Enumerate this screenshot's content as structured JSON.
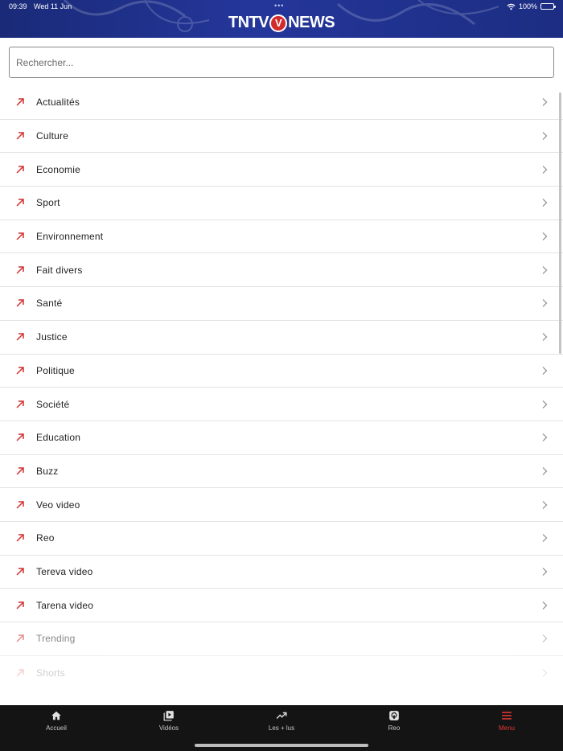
{
  "status_bar": {
    "time": "09:39",
    "date": "Wed 11 Jun",
    "dots": "•••",
    "battery": "100%"
  },
  "header": {
    "logo_left": "TNTV",
    "logo_badge": "V",
    "logo_right": "NEWS"
  },
  "search": {
    "placeholder": "Rechercher..."
  },
  "menu": {
    "items": [
      {
        "label": "Actualités"
      },
      {
        "label": "Culture"
      },
      {
        "label": "Economie"
      },
      {
        "label": "Sport"
      },
      {
        "label": "Environnement"
      },
      {
        "label": "Fait divers"
      },
      {
        "label": "Santé"
      },
      {
        "label": "Justice"
      },
      {
        "label": "Politique"
      },
      {
        "label": "Société"
      },
      {
        "label": "Education"
      },
      {
        "label": "Buzz"
      },
      {
        "label": "Veo video"
      },
      {
        "label": "Reo"
      },
      {
        "label": "Tereva video"
      },
      {
        "label": "Tarena video"
      },
      {
        "label": "Trending"
      },
      {
        "label": "Shorts"
      }
    ]
  },
  "bottom_nav": {
    "tabs": [
      {
        "label": "Accueil",
        "icon": "home-icon"
      },
      {
        "label": "Vidéos",
        "icon": "video-library-icon"
      },
      {
        "label": "Les + lus",
        "icon": "trending-icon"
      },
      {
        "label": "Reo",
        "icon": "podcast-icon"
      },
      {
        "label": "Menu",
        "icon": "menu-icon"
      }
    ],
    "active_index": 4
  },
  "colors": {
    "accent": "#e53935",
    "header_bg": "#1f2f88",
    "nav_bg": "#141414"
  }
}
